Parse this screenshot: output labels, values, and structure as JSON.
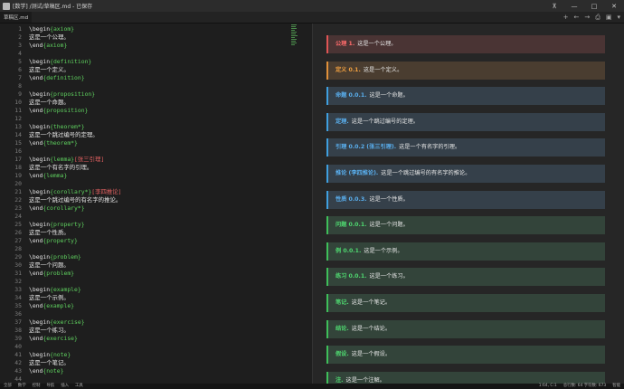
{
  "window": {
    "title": "[数学] /测试/草稿区.md - 已保存",
    "controls": [
      "pin",
      "minimize",
      "maximize",
      "close"
    ]
  },
  "tabs": [
    {
      "label": "草稿区.md"
    }
  ],
  "editor_lines": [
    {
      "n": "1",
      "parts": [
        {
          "t": "\\begin",
          "c": "t"
        },
        {
          "t": "{axiom}",
          "c": "arg"
        }
      ]
    },
    {
      "n": "2",
      "parts": [
        {
          "t": "这是一个公理。",
          "c": "t"
        }
      ]
    },
    {
      "n": "3",
      "parts": [
        {
          "t": "\\end",
          "c": "t"
        },
        {
          "t": "{axiom}",
          "c": "arg"
        }
      ]
    },
    {
      "n": "4",
      "parts": []
    },
    {
      "n": "5",
      "parts": [
        {
          "t": "\\begin",
          "c": "t"
        },
        {
          "t": "{definition}",
          "c": "arg"
        }
      ]
    },
    {
      "n": "6",
      "parts": [
        {
          "t": "这是一个定义。",
          "c": "t"
        }
      ]
    },
    {
      "n": "7",
      "parts": [
        {
          "t": "\\end",
          "c": "t"
        },
        {
          "t": "{definition}",
          "c": "arg"
        }
      ]
    },
    {
      "n": "8",
      "parts": []
    },
    {
      "n": "9",
      "parts": [
        {
          "t": "\\begin",
          "c": "t"
        },
        {
          "t": "{proposition}",
          "c": "arg"
        }
      ]
    },
    {
      "n": "10",
      "parts": [
        {
          "t": "这是一个命题。",
          "c": "t"
        }
      ]
    },
    {
      "n": "11",
      "parts": [
        {
          "t": "\\end",
          "c": "t"
        },
        {
          "t": "{proposition}",
          "c": "arg"
        }
      ]
    },
    {
      "n": "12",
      "parts": []
    },
    {
      "n": "13",
      "parts": [
        {
          "t": "\\begin",
          "c": "t"
        },
        {
          "t": "{theorem*}",
          "c": "arg"
        }
      ]
    },
    {
      "n": "14",
      "parts": [
        {
          "t": "这是一个跳过编号的定理。",
          "c": "t"
        }
      ]
    },
    {
      "n": "15",
      "parts": [
        {
          "t": "\\end",
          "c": "t"
        },
        {
          "t": "{theorem*}",
          "c": "arg"
        }
      ]
    },
    {
      "n": "16",
      "parts": []
    },
    {
      "n": "17",
      "parts": [
        {
          "t": "\\begin",
          "c": "t"
        },
        {
          "t": "{lemma}",
          "c": "arg"
        },
        {
          "t": "[张三引理]",
          "c": "opt"
        }
      ]
    },
    {
      "n": "18",
      "parts": [
        {
          "t": "这是一个有名字的引理。",
          "c": "t"
        }
      ]
    },
    {
      "n": "19",
      "parts": [
        {
          "t": "\\end",
          "c": "t"
        },
        {
          "t": "{lemma}",
          "c": "arg"
        }
      ]
    },
    {
      "n": "20",
      "parts": []
    },
    {
      "n": "21",
      "parts": [
        {
          "t": "\\begin",
          "c": "t"
        },
        {
          "t": "{corollary*}",
          "c": "arg"
        },
        {
          "t": "[李四推论]",
          "c": "opt"
        }
      ]
    },
    {
      "n": "22",
      "parts": [
        {
          "t": "这是一个跳过编号的有名字的推论。",
          "c": "t"
        }
      ]
    },
    {
      "n": "23",
      "parts": [
        {
          "t": "\\end",
          "c": "t"
        },
        {
          "t": "{corollary*}",
          "c": "arg"
        }
      ]
    },
    {
      "n": "24",
      "parts": []
    },
    {
      "n": "25",
      "parts": [
        {
          "t": "\\begin",
          "c": "t"
        },
        {
          "t": "{property}",
          "c": "arg"
        }
      ]
    },
    {
      "n": "26",
      "parts": [
        {
          "t": "这是一个性质。",
          "c": "t"
        }
      ]
    },
    {
      "n": "27",
      "parts": [
        {
          "t": "\\end",
          "c": "t"
        },
        {
          "t": "{property}",
          "c": "arg"
        }
      ]
    },
    {
      "n": "28",
      "parts": []
    },
    {
      "n": "29",
      "parts": [
        {
          "t": "\\begin",
          "c": "t"
        },
        {
          "t": "{problem}",
          "c": "arg"
        }
      ]
    },
    {
      "n": "30",
      "parts": [
        {
          "t": "这是一个问题。",
          "c": "t"
        }
      ]
    },
    {
      "n": "31",
      "parts": [
        {
          "t": "\\end",
          "c": "t"
        },
        {
          "t": "{problem}",
          "c": "arg"
        }
      ]
    },
    {
      "n": "32",
      "parts": []
    },
    {
      "n": "33",
      "parts": [
        {
          "t": "\\begin",
          "c": "t"
        },
        {
          "t": "{example}",
          "c": "arg"
        }
      ]
    },
    {
      "n": "34",
      "parts": [
        {
          "t": "这是一个示例。",
          "c": "t"
        }
      ]
    },
    {
      "n": "35",
      "parts": [
        {
          "t": "\\end",
          "c": "t"
        },
        {
          "t": "{example}",
          "c": "arg"
        }
      ]
    },
    {
      "n": "36",
      "parts": []
    },
    {
      "n": "37",
      "parts": [
        {
          "t": "\\begin",
          "c": "t"
        },
        {
          "t": "{exercise}",
          "c": "arg"
        }
      ]
    },
    {
      "n": "38",
      "parts": [
        {
          "t": "这是一个练习。",
          "c": "t"
        }
      ]
    },
    {
      "n": "39",
      "parts": [
        {
          "t": "\\end",
          "c": "t"
        },
        {
          "t": "{exercise}",
          "c": "arg"
        }
      ]
    },
    {
      "n": "40",
      "parts": []
    },
    {
      "n": "41",
      "parts": [
        {
          "t": "\\begin",
          "c": "t"
        },
        {
          "t": "{note}",
          "c": "arg"
        }
      ]
    },
    {
      "n": "42",
      "parts": [
        {
          "t": "这是一个笔记。",
          "c": "t"
        }
      ]
    },
    {
      "n": "43",
      "parts": [
        {
          "t": "\\end",
          "c": "t"
        },
        {
          "t": "{note}",
          "c": "arg"
        }
      ]
    },
    {
      "n": "44",
      "parts": []
    },
    {
      "n": "45",
      "parts": [
        {
          "t": "\\begin",
          "c": "t"
        },
        {
          "t": "{conclusion}",
          "c": "arg"
        }
      ]
    }
  ],
  "preview_cards": [
    {
      "label": "公理 1.",
      "text": "这是一个公理。",
      "accent": "#e05555",
      "bg": "#4a3434",
      "label_color": "#ff6b6b"
    },
    {
      "label": "定义 0.1.",
      "text": "这是一个定义。",
      "accent": "#e0903a",
      "bg": "#4a3d30",
      "label_color": "#f0a040"
    },
    {
      "label": "命题 0.0.1.",
      "text": "这是一个命题。",
      "accent": "#3fa0e0",
      "bg": "#35404a",
      "label_color": "#5ab0f0"
    },
    {
      "label": "定理.",
      "text": "这是一个跳过编号的定理。",
      "accent": "#3fa0e0",
      "bg": "#35404a",
      "label_color": "#5ab0f0"
    },
    {
      "label": "引理 0.0.2 (张三引理).",
      "text": "这是一个有名字的引理。",
      "accent": "#3fa0e0",
      "bg": "#35404a",
      "label_color": "#5ab0f0"
    },
    {
      "label": "推论 (李四推论).",
      "text": "这是一个跳过编号的有名字的推论。",
      "accent": "#3fa0e0",
      "bg": "#35404a",
      "label_color": "#5ab0f0"
    },
    {
      "label": "性质 0.0.3.",
      "text": "这是一个性质。",
      "accent": "#3fa0e0",
      "bg": "#35404a",
      "label_color": "#5ab0f0"
    },
    {
      "label": "问题 0.0.1.",
      "text": "这是一个问题。",
      "accent": "#3fbf5a",
      "bg": "#33443a",
      "label_color": "#4fd870"
    },
    {
      "label": "例 0.0.1.",
      "text": "这是一个示例。",
      "accent": "#3fbf5a",
      "bg": "#33443a",
      "label_color": "#4fd870"
    },
    {
      "label": "练习 0.0.1.",
      "text": "这是一个练习。",
      "accent": "#3fbf5a",
      "bg": "#33443a",
      "label_color": "#4fd870"
    },
    {
      "label": "笔记.",
      "text": "这是一个笔记。",
      "accent": "#3fbf5a",
      "bg": "#33443a",
      "label_color": "#4fd870"
    },
    {
      "label": "结论.",
      "text": "这是一个结论。",
      "accent": "#3fbf5a",
      "bg": "#33443a",
      "label_color": "#4fd870"
    },
    {
      "label": "假设.",
      "text": "这是一个假设。",
      "accent": "#3fbf5a",
      "bg": "#33443a",
      "label_color": "#4fd870"
    },
    {
      "label": "注.",
      "text": "这是一个注解。",
      "accent": "#3fbf5a",
      "bg": "#33443a",
      "label_color": "#4fd870"
    }
  ],
  "statusbar": {
    "left": [
      "全部",
      "数学",
      "控制",
      "导航",
      "插入",
      "工具"
    ],
    "cursor": "1:64, C:1",
    "counts": "总行数: 64  字符数: 673",
    "mode": "智能"
  }
}
